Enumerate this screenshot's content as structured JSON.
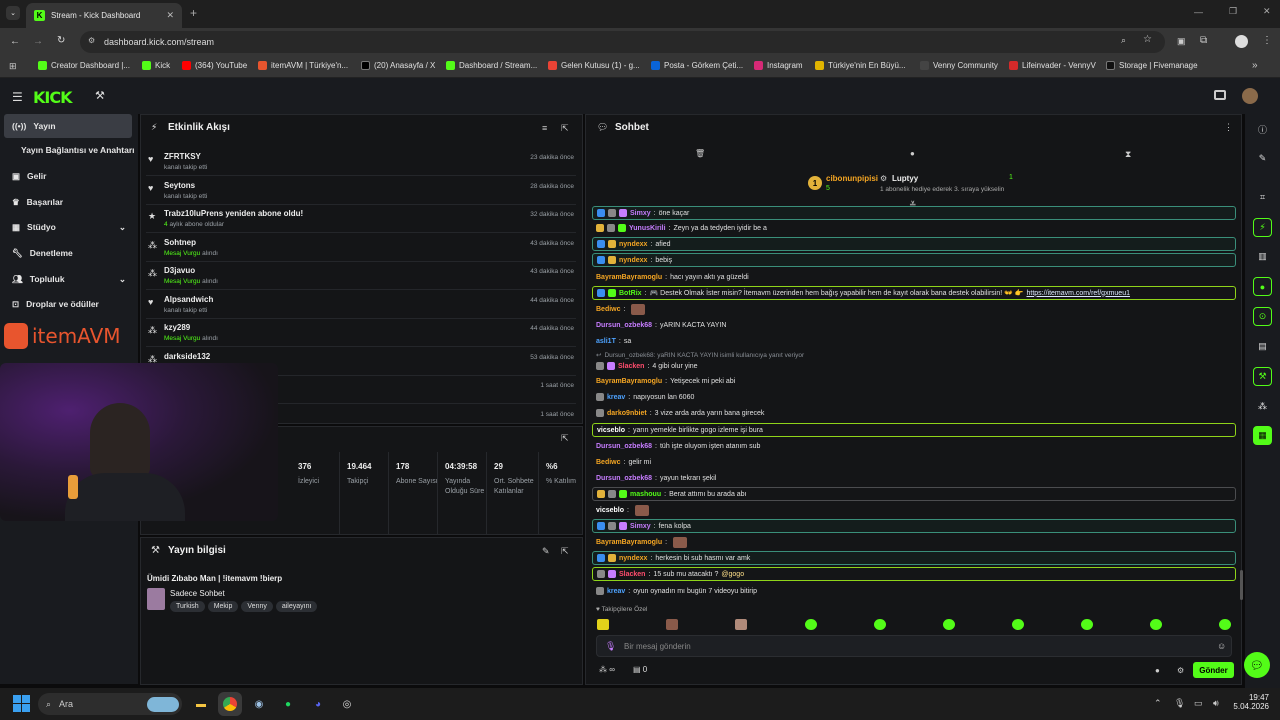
{
  "browser": {
    "tab_title": "Stream - Kick Dashboard",
    "url": "dashboard.kick.com/stream"
  },
  "bookmarks": [
    "Creator Dashboard |...",
    "Kick",
    "(364) YouTube",
    "itemAVM | Türkiye'n...",
    "(20) Anasayfa / X",
    "Dashboard / Stream...",
    "Gelen Kutusu (1) - g...",
    "Posta - Görkem Çeti...",
    "Instagram",
    "Türkiye'nin En Büyü...",
    "Venny Community",
    "Lifeinvader - VennyV",
    "Storage | Fivemanage"
  ],
  "logo": "KICK",
  "sidebar": {
    "items": [
      "Yayın",
      "Yayın Bağlantısı ve Anahtarı",
      "Gelir",
      "Başarılar",
      "Stüdyo",
      "Denetleme",
      "Topluluk",
      "Droplar ve ödüller"
    ],
    "brand": "itemAVM"
  },
  "activity": {
    "title": "Etkinlik Akışı",
    "events": [
      {
        "name": "ZFRTKSY",
        "sub": "kanalı takip etti",
        "time": "23 dakika önce",
        "icon": "♥"
      },
      {
        "name": "Seytons",
        "sub": "kanalı takip etti",
        "time": "28 dakika önce",
        "icon": "♥"
      },
      {
        "name": "Trabz10luPrens yeniden abone oldu!",
        "sub_green": "4",
        "sub": "aylık abone oldular",
        "time": "32 dakika önce",
        "icon": "★"
      },
      {
        "name": "Sohtnep",
        "sub_green": "Mesaj Vurgu",
        "sub": "alındı",
        "time": "43 dakika önce",
        "icon": "⁂"
      },
      {
        "name": "D3javuo",
        "sub_green": "Mesaj Vurgu",
        "sub": "alındı",
        "time": "43 dakika önce",
        "icon": "⁂"
      },
      {
        "name": "Alpsandwich",
        "sub": "kanalı takip etti",
        "time": "44 dakika önce",
        "icon": "♥"
      },
      {
        "name": "kzy289",
        "sub_green": "Mesaj Vurgu",
        "sub": "alındı",
        "time": "44 dakika önce",
        "icon": "⁂"
      },
      {
        "name": "darkside132",
        "sub": "",
        "time": "53 dakika önce",
        "icon": "⁂"
      },
      {
        "name": "",
        "sub": "",
        "time": "1 saat önce",
        "icon": ""
      },
      {
        "name": "",
        "sub": "",
        "time": "1 saat önce",
        "icon": ""
      }
    ]
  },
  "stats": [
    {
      "v": "376",
      "l": "İzleyici"
    },
    {
      "v": "19.464",
      "l": "Takipçi"
    },
    {
      "v": "178",
      "l": "Abone Sayısı"
    },
    {
      "v": "04:39:58",
      "l": "Yayında Olduğu Süre"
    },
    {
      "v": "29",
      "l": "Ort. Sohbete Katılanlar"
    },
    {
      "v": "%6",
      "l": "% Katılım"
    }
  ],
  "stream_info": {
    "title": "Yayın bilgisi",
    "stream_title": "Ümidi Zıbabo Man | !itemavm !bierp",
    "category": "Sadece Sohbet",
    "tags": [
      "Turkish",
      "Mekip",
      "Venny",
      "aileyayını"
    ]
  },
  "chat": {
    "title": "Sohbet",
    "top_gifter": {
      "name": "cibonunpipisi",
      "count": "5"
    },
    "gift_user": {
      "name": "Luptyy",
      "count": "1",
      "desc": "1 abonelik hediye ederek 3. sıraya yükselin"
    },
    "messages": [
      {
        "u": "Simxy",
        "c": "#c77dff",
        "t": "öne kaçar"
      },
      {
        "u": "YunusKirili",
        "c": "#c77dff",
        "t": "Zeyn ya da tedyden iyidir be a"
      },
      {
        "u": "nyndexx",
        "c": "#f5a623",
        "t": "afied"
      },
      {
        "u": "nyndexx",
        "c": "#f5a623",
        "t": "bebiş"
      },
      {
        "u": "BayramBayramoglu",
        "c": "#f5a623",
        "t": "hacı yayın aktı ya güzeldi"
      },
      {
        "u": "BotRix",
        "c": "#53fc18",
        "t": "🎮 Destek Olmak İster misin? İtemavm üzerinden hem bağış yapabilir hem de kayıt olarak bana destek olabilirsin! 👐 👉",
        "link": "https://itemavm.com/ref/gxmueu1"
      },
      {
        "u": "Bediwc",
        "c": "#f5a623",
        "t": ""
      },
      {
        "u": "Dursun_ozbek68",
        "c": "#c77dff",
        "t": "yARIN KACTA YAYIN"
      },
      {
        "u": "asli1T",
        "c": "#4ea3ff",
        "t": "sa"
      },
      {
        "reply": "Dursun_ozbek68: yaRIN KACTA YAYIN isimli kullanıcıya yanıt veriyor"
      },
      {
        "u": "Slacken",
        "c": "#ff4d6d",
        "t": "4 gibi olur yine"
      },
      {
        "u": "BayramBayramoglu",
        "c": "#f5a623",
        "t": "Yetişecek mi peki abi"
      },
      {
        "u": "kreav",
        "c": "#4ea3ff",
        "t": "napıyosun lan 6060"
      },
      {
        "u": "darko9nbiet",
        "c": "#f5a623",
        "t": "3 vize arda arda yarın bana girecek"
      },
      {
        "u": "vicseblo",
        "c": "#ffffff",
        "t": "yarın yemekle birlikte gogo izleme işi bura"
      },
      {
        "u": "Dursun_ozbek68",
        "c": "#c77dff",
        "t": "tüh işte oluyom işten atanım sub"
      },
      {
        "u": "Bediwc",
        "c": "#f5a623",
        "t": "gelir mi"
      },
      {
        "u": "Dursun_ozbek68",
        "c": "#c77dff",
        "t": "yayun tekrarı şekil"
      },
      {
        "u": "mashouu",
        "c": "#53fc18",
        "t": "Berat attımı bu arada abı"
      },
      {
        "u": "vicseblo",
        "c": "#ffffff",
        "t": ""
      },
      {
        "u": "Simxy",
        "c": "#c77dff",
        "t": "fena kolpa"
      },
      {
        "u": "BayramBayramoglu",
        "c": "#f5a623",
        "t": ""
      },
      {
        "u": "nyndexx",
        "c": "#f5a623",
        "t": "herkesin bi sub hasmı var amk"
      },
      {
        "u": "Slacken",
        "c": "#ff4d6d",
        "t": "15 sub mu atacaktı ?",
        "mention": "@gogo"
      },
      {
        "u": "kreav",
        "c": "#4ea3ff",
        "t": "oyun oynadın mı bugün 7 videoyu bitirip"
      }
    ],
    "emote_label": "Takipçilere Özel",
    "placeholder": "Bir mesaj gönderin",
    "infinity": "∞",
    "count_zero": "0",
    "send": "Gönder"
  },
  "taskbar": {
    "search": "Ara",
    "time": "19:47",
    "date": "5.04.2026"
  }
}
